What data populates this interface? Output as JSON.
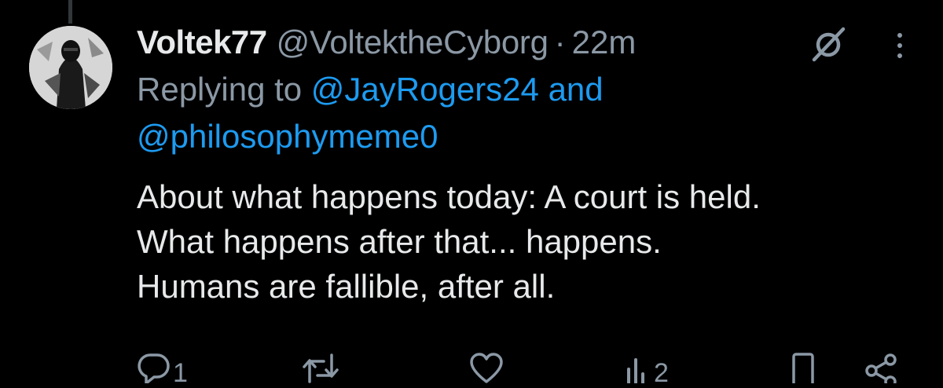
{
  "tweet": {
    "display_name": "Voltek77",
    "handle": "@VoltektheCyborg",
    "separator": "·",
    "timestamp": "22m",
    "replying_prefix": "Replying to",
    "replying_mention_1": "@JayRogers24",
    "replying_and": "and",
    "replying_mention_2": "@philosophymeme0",
    "text_lines": [
      "About what happens today: A court is held.",
      "What happens after that... happens.",
      "Humans are fallible, after all."
    ]
  },
  "actions": {
    "reply_count": "1",
    "retweet_count": "",
    "like_count": "",
    "views_count": "2"
  },
  "icons": {
    "grok": "grok-icon",
    "more": "more-dots-icon",
    "reply": "reply-icon",
    "retweet": "retweet-icon",
    "like": "heart-icon",
    "views": "views-icon",
    "bookmark": "bookmark-icon",
    "share": "share-icon"
  },
  "colors": {
    "background": "#000000",
    "text_primary": "#e7e9ea",
    "text_secondary": "#8b98a5",
    "link": "#1d9bf0"
  }
}
